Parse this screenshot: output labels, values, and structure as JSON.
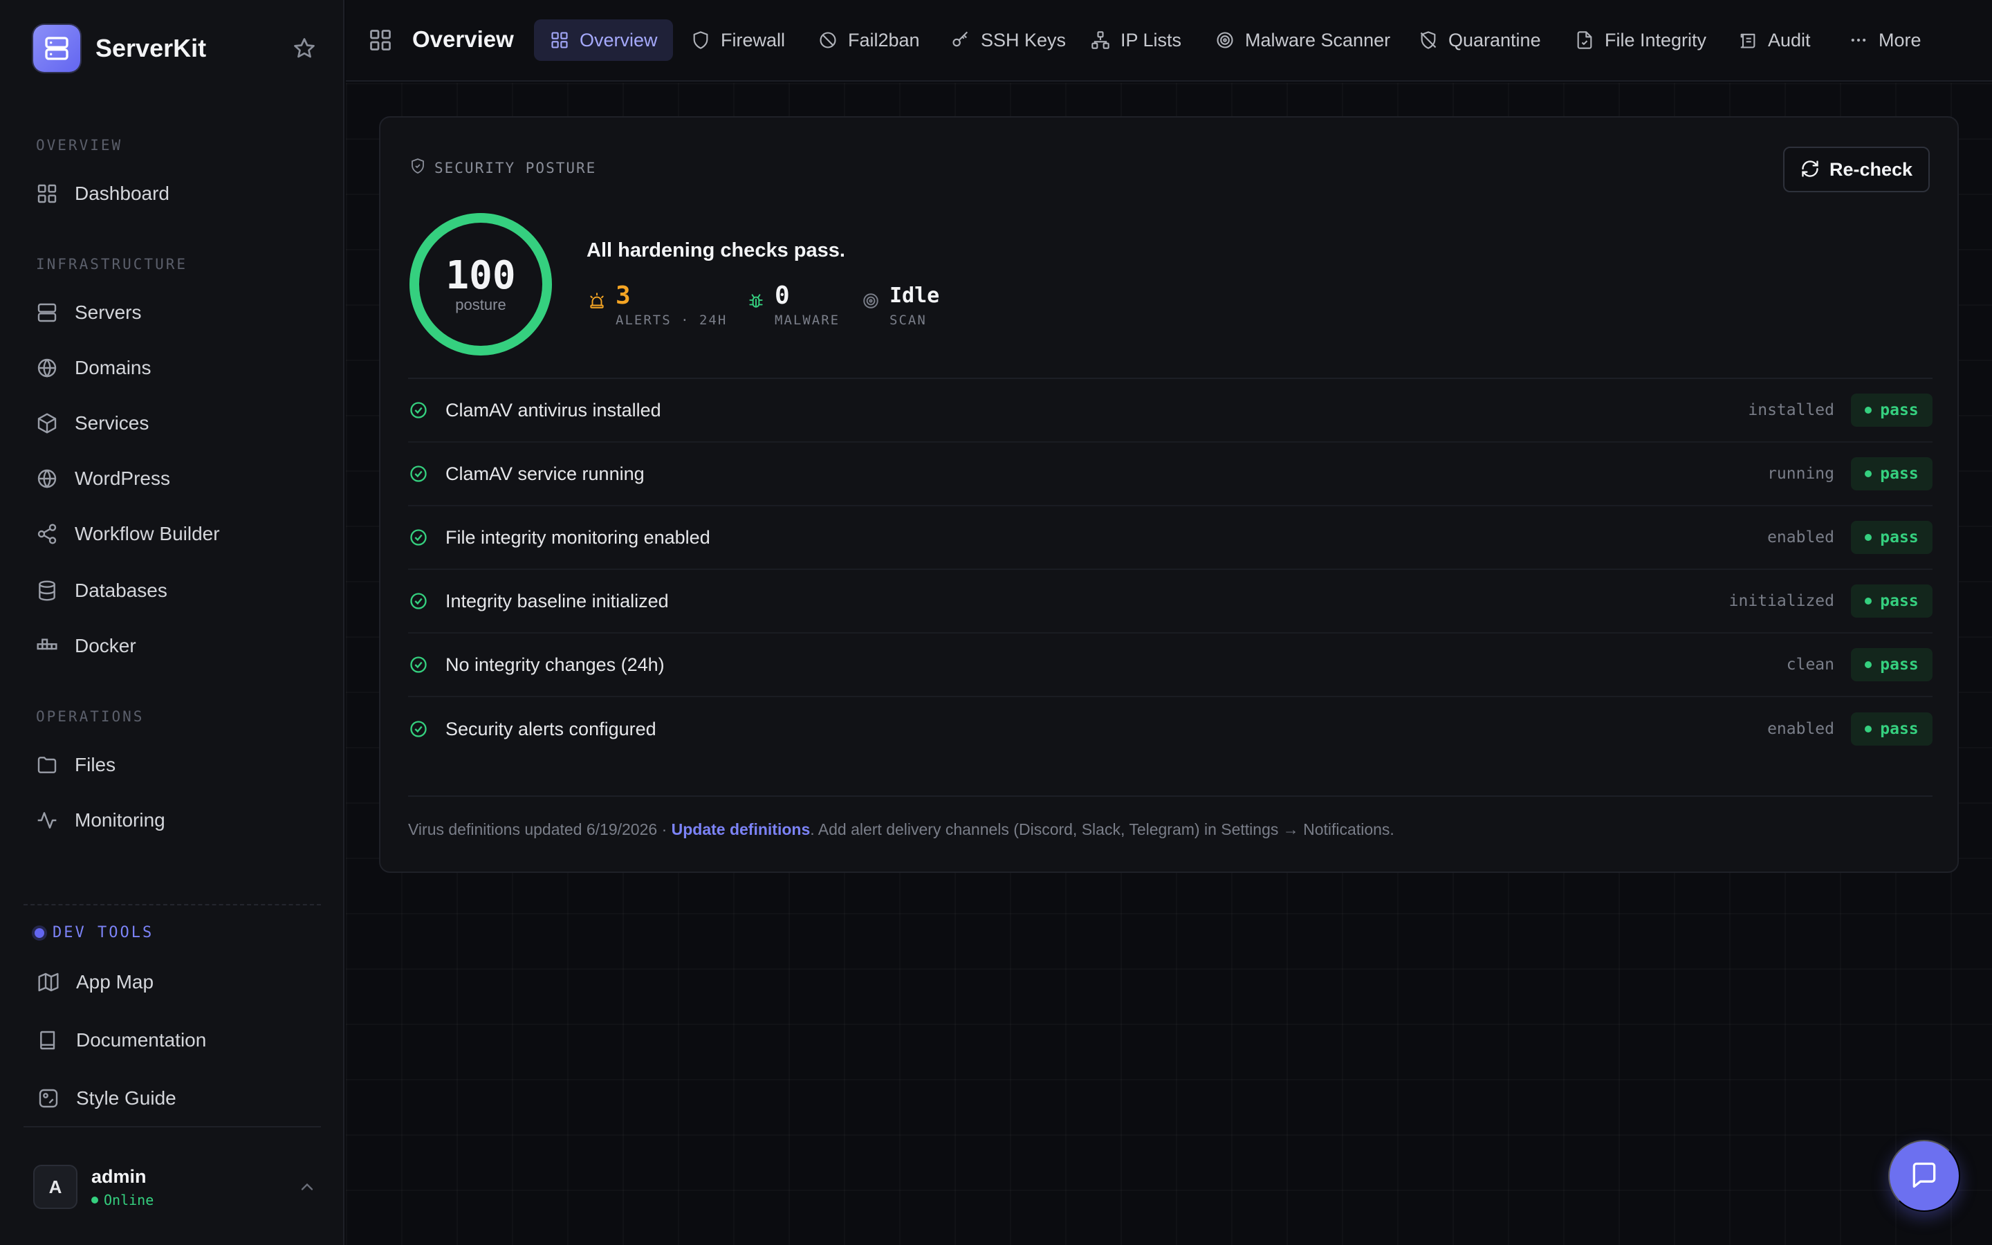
{
  "brand": {
    "name": "ServerKit"
  },
  "sidebar": {
    "sections": [
      {
        "label": "OVERVIEW",
        "items": [
          {
            "label": "Dashboard",
            "icon": "grid-icon"
          }
        ]
      },
      {
        "label": "INFRASTRUCTURE",
        "items": [
          {
            "label": "Servers",
            "icon": "server-icon"
          },
          {
            "label": "Domains",
            "icon": "globe-icon"
          },
          {
            "label": "Services",
            "icon": "box-icon"
          },
          {
            "label": "WordPress",
            "icon": "wordpress-icon"
          },
          {
            "label": "Workflow Builder",
            "icon": "share-icon"
          },
          {
            "label": "Databases",
            "icon": "database-icon"
          },
          {
            "label": "Docker",
            "icon": "docker-icon"
          }
        ]
      },
      {
        "label": "OPERATIONS",
        "items": [
          {
            "label": "Files",
            "icon": "folder-icon"
          },
          {
            "label": "Monitoring",
            "icon": "activity-icon"
          }
        ]
      }
    ],
    "dev_tools": {
      "label": "DEV TOOLS",
      "items": [
        {
          "label": "App Map",
          "icon": "map-icon"
        },
        {
          "label": "Documentation",
          "icon": "book-icon"
        },
        {
          "label": "Style Guide",
          "icon": "palette-icon"
        }
      ]
    },
    "user": {
      "initial": "A",
      "name": "admin",
      "status": "Online"
    }
  },
  "header": {
    "title": "Overview",
    "tabs": [
      {
        "label": "Overview",
        "icon": "grid-icon",
        "active": true
      },
      {
        "label": "Firewall",
        "icon": "shield-icon"
      },
      {
        "label": "Fail2ban",
        "icon": "ban-icon"
      },
      {
        "label": "SSH Keys",
        "icon": "key-icon"
      },
      {
        "label": "IP Lists",
        "icon": "network-icon"
      },
      {
        "label": "Malware Scanner",
        "icon": "radar-icon"
      },
      {
        "label": "Quarantine",
        "icon": "shield-off-icon"
      },
      {
        "label": "File Integrity",
        "icon": "file-check-icon"
      },
      {
        "label": "Audit",
        "icon": "scroll-icon"
      },
      {
        "label": "More",
        "icon": "more-icon"
      }
    ]
  },
  "posture": {
    "section_label": "SECURITY POSTURE",
    "recheck_label": "Re-check",
    "score": "100",
    "score_label": "posture",
    "score_fraction": 1.0,
    "summary": "All hardening checks pass.",
    "stats": {
      "alerts": {
        "value": "3",
        "caption": "ALERTS · 24H"
      },
      "malware": {
        "value": "0",
        "caption": "MALWARE"
      },
      "scan": {
        "value": "Idle",
        "caption": "SCAN"
      }
    },
    "checks": [
      {
        "label": "ClamAV antivirus installed",
        "status": "installed",
        "result": "pass"
      },
      {
        "label": "ClamAV service running",
        "status": "running",
        "result": "pass"
      },
      {
        "label": "File integrity monitoring enabled",
        "status": "enabled",
        "result": "pass"
      },
      {
        "label": "Integrity baseline initialized",
        "status": "initialized",
        "result": "pass"
      },
      {
        "label": "No integrity changes (24h)",
        "status": "clean",
        "result": "pass"
      },
      {
        "label": "Security alerts configured",
        "status": "enabled",
        "result": "pass"
      }
    ],
    "footer": {
      "prefix": "Virus definitions updated 6/19/2026 · ",
      "link": "Update definitions",
      "suffix": ". Add alert delivery channels (Discord, Slack, Telegram) in Settings → Notifications."
    }
  },
  "colors": {
    "accent": "#6366f1",
    "success": "#35d07f",
    "warning": "#f5a524",
    "background": "#0b0c10"
  }
}
